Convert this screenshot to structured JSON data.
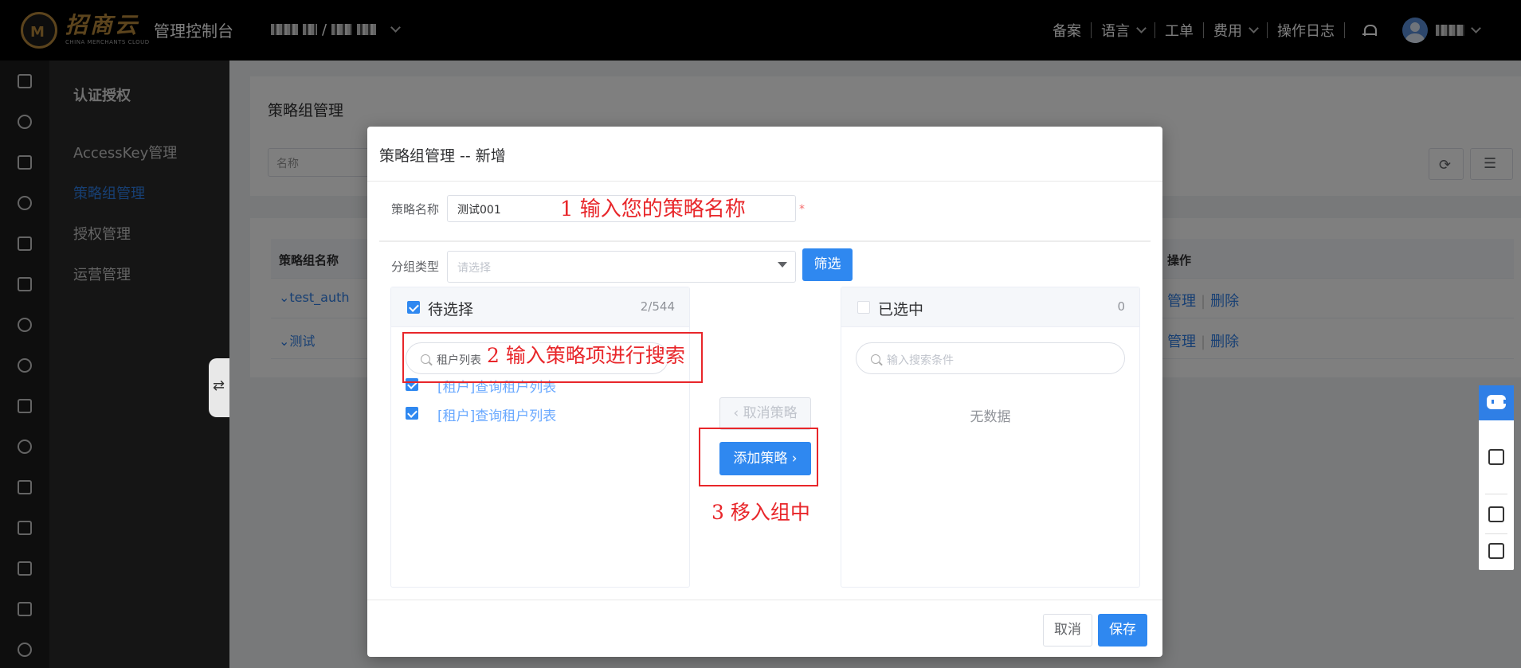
{
  "topbar": {
    "logo_text": "招商云",
    "logo_en": "CHINA MERCHANTS CLOUD",
    "console_title": "管理控制台",
    "nav": [
      "备案",
      "语言",
      "工单",
      "费用",
      "操作日志"
    ]
  },
  "sidebar": {
    "section_title": "认证授权",
    "items": [
      "AccessKey管理",
      "策略组管理",
      "授权管理",
      "运营管理"
    ],
    "active_index": 1
  },
  "page": {
    "title": "策略组管理",
    "name_placeholder": "名称",
    "table": {
      "headers": [
        "策略组名称",
        "操作"
      ],
      "rows": [
        {
          "name": "test_auth",
          "ops": [
            "管理",
            "删除"
          ]
        },
        {
          "name": "测试",
          "ops": [
            "管理",
            "删除"
          ]
        }
      ]
    }
  },
  "dialog": {
    "title": "策略组管理 -- 新增",
    "name_label": "策略名称",
    "name_value": "测试001",
    "required_mark": "*",
    "group_type_label": "分组类型",
    "group_type_placeholder": "请选择",
    "filter_button": "筛选",
    "left_panel": {
      "title": "待选择",
      "count": "2/544",
      "search_value": "租户列表",
      "items": [
        "[租户]查询租户列表",
        "[租户]查询租户列表"
      ]
    },
    "cancel_policy_button": "取消策略",
    "add_policy_button": "添加策略",
    "right_panel": {
      "title": "已选中",
      "count": "0",
      "search_placeholder": "输入搜索条件",
      "empty_text": "无数据"
    },
    "cancel_button": "取消",
    "save_button": "保存"
  },
  "annotations": {
    "step1": "1 输入您的策略名称",
    "step2": "2 输入策略项进行搜索",
    "step3": "3 移入组中"
  },
  "colors": {
    "primary": "#2f88f0",
    "annotation_red": "#e8262a",
    "brand_gold": "#b8893b"
  }
}
